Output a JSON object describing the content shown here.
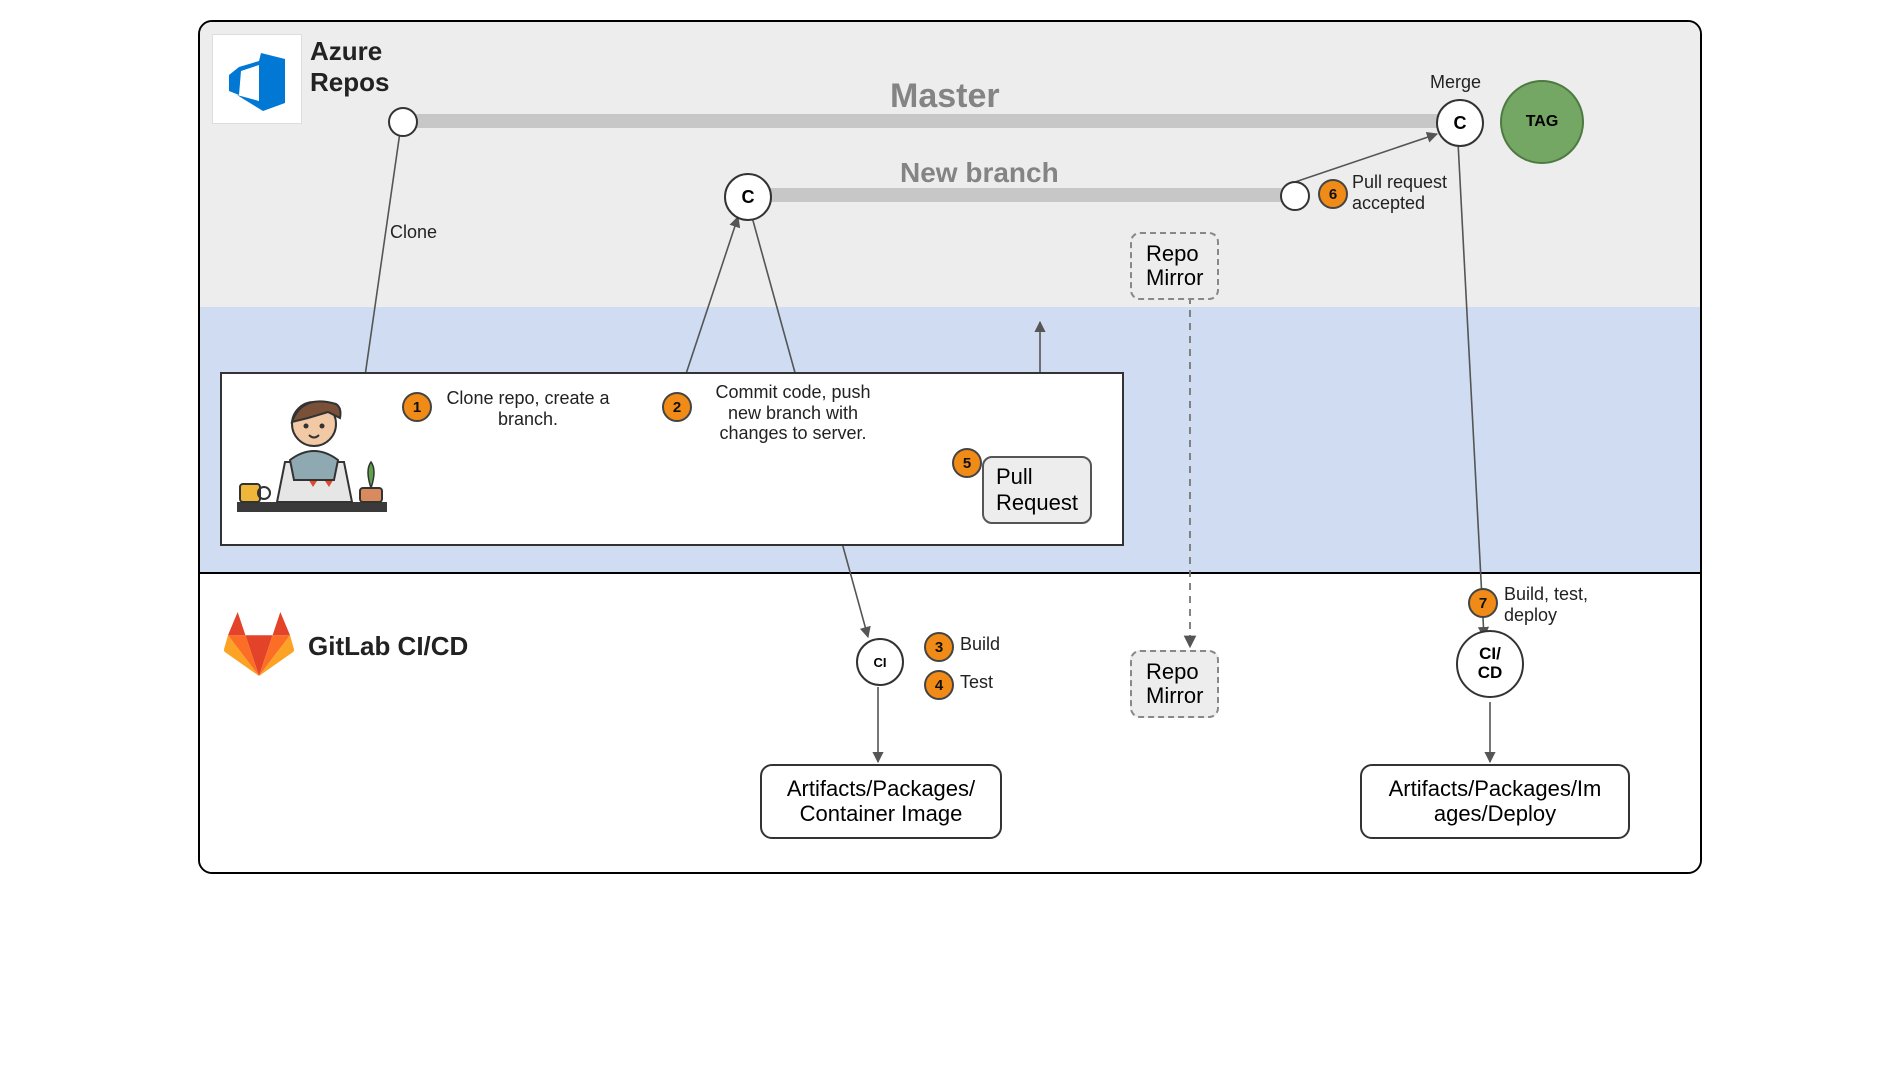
{
  "sections": {
    "azure": "Azure\nRepos",
    "gitlab": "GitLab CI/CD"
  },
  "branches": {
    "master": "Master",
    "new": "New branch"
  },
  "merge": {
    "label": "Merge",
    "commit": "C",
    "tag": "TAG"
  },
  "newbranch_commit": "C",
  "clone_label": "Clone",
  "steps": {
    "1": {
      "num": "1",
      "text": "Clone repo, create a branch."
    },
    "2": {
      "num": "2",
      "text": "Commit code, push new branch with changes to server."
    },
    "3": {
      "num": "3",
      "text": "Build"
    },
    "4": {
      "num": "4",
      "text": "Test"
    },
    "5": {
      "num": "5",
      "text": "Pull\nRequest"
    },
    "6": {
      "num": "6",
      "text": "Pull request accepted"
    },
    "7": {
      "num": "7",
      "text": "Build, test, deploy"
    }
  },
  "repo_mirror": "Repo\nMirror",
  "ci_nodes": {
    "ci": "CI",
    "cicd": "CI/\nCD"
  },
  "artifacts": {
    "left": "Artifacts/Packages/\nContainer Image",
    "right": "Artifacts/Packages/Im\nages/Deploy"
  }
}
